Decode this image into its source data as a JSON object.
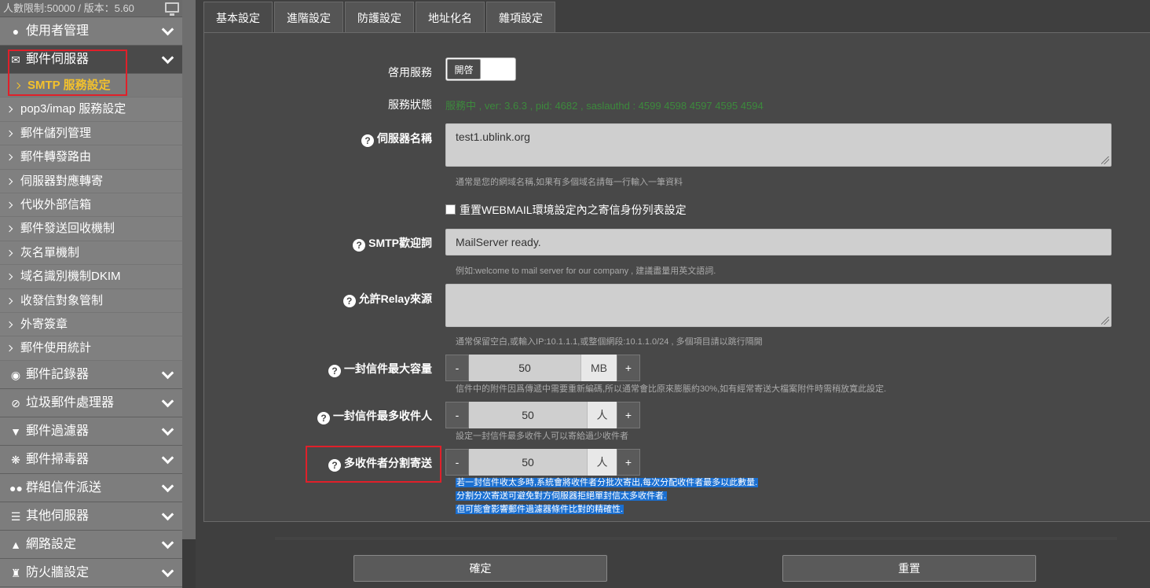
{
  "header": {
    "user_limit": "人數限制:50000 / 版本：5.60"
  },
  "sidebar": {
    "sections_top": [
      {
        "label": "使用者管理",
        "icon": "user-icon"
      },
      {
        "label": "郵件伺服器",
        "icon": "envelope-icon"
      }
    ],
    "sub_items": [
      "SMTP 服務設定",
      "pop3/imap 服務設定",
      "郵件儲列管理",
      "郵件轉發路由",
      "伺服器對應轉寄",
      "代收外部信箱",
      "郵件發送回收機制",
      "灰名單機制",
      "域名識別機制DKIM",
      "收發信對象管制",
      "外寄簽章",
      "郵件使用統計"
    ],
    "sections_bottom": [
      {
        "label": "郵件記錄器",
        "icon": "camera-icon"
      },
      {
        "label": "垃圾郵件處理器",
        "icon": "ban-icon"
      },
      {
        "label": "郵件過濾器",
        "icon": "filter-icon"
      },
      {
        "label": "郵件掃毒器",
        "icon": "bug-icon"
      },
      {
        "label": "群組信件派送",
        "icon": "users-icon"
      },
      {
        "label": "其他伺服器",
        "icon": "server-icon"
      },
      {
        "label": "網路設定",
        "icon": "sitemap-icon"
      },
      {
        "label": "防火牆設定",
        "icon": "castle-icon"
      }
    ]
  },
  "tabs": [
    "基本設定",
    "進階設定",
    "防護設定",
    "地址化名",
    "雜項設定"
  ],
  "form": {
    "enable_label": "啓用服務",
    "toggle_on": "開啓",
    "status_label": "服務狀態",
    "status_value": "服務中 , ver: 3.6.3 , pid: 4682 , saslauthd : 4599 4598 4597 4595 4594",
    "server_name_label": "伺服器名稱",
    "server_name_value": "test1.ublink.org",
    "server_name_hint": "通常是您的網域名稱,如果有多個域名請每一行輸入一筆資料",
    "reset_checkbox_label": "重置WEBMAIL環境設定內之寄信身份列表設定",
    "greeting_label": "SMTP歡迎詞",
    "greeting_value": "MailServer ready.",
    "greeting_hint": "例如:welcome to mail server for our company , 建議盡量用英文語詞.",
    "relay_label": "允許Relay來源",
    "relay_value": "",
    "relay_hint": "通常保留空白,或輸入IP:10.1.1.1,或整個網段:10.1.1.0/24 , 多個項目請以跳行隔開",
    "max_size_label": "一封信件最大容量",
    "max_size_value": "50",
    "max_size_unit": "MB",
    "max_size_hint": "信件中的附件因爲傳遞中需要重新編碼,所以通常會比原來膨脹約30%,如有經常寄送大檔案附件時需稍放寬此設定.",
    "max_rcpt_label": "一封信件最多收件人",
    "max_rcpt_value": "50",
    "max_rcpt_unit": "人",
    "max_rcpt_hint": "設定一封信件最多收件人可以寄給過少收件者",
    "split_label": "多收件者分割寄送",
    "split_value": "50",
    "split_unit": "人",
    "split_hint_lines": [
      "若一封信件收太多時,系統會將收件者分批次寄出,每次分配收件者最多以此數量.",
      "分割分次寄送可避免對方伺服器拒絕單封信太多收件者.",
      "但可能會影響郵件過濾器條件比對的精確性."
    ],
    "minus": "-",
    "plus": "+"
  },
  "buttons": {
    "confirm": "確定",
    "reset": "重置"
  }
}
